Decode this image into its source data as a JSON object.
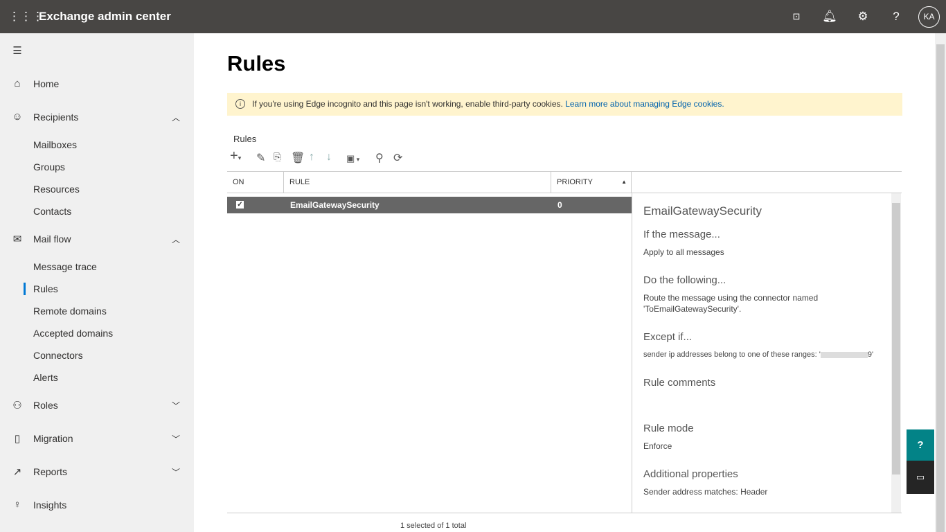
{
  "header": {
    "app_title": "Exchange admin center",
    "avatar": "KA",
    "icons": [
      "waffle-icon",
      "terminal-icon",
      "bell-icon",
      "gear-icon",
      "help-icon"
    ]
  },
  "sidebar": {
    "items": [
      {
        "label": "Home",
        "icon": "home-icon"
      },
      {
        "label": "Recipients",
        "icon": "person-icon",
        "expanded": true,
        "children": [
          "Mailboxes",
          "Groups",
          "Resources",
          "Contacts"
        ]
      },
      {
        "label": "Mail flow",
        "icon": "mail-icon",
        "expanded": true,
        "children": [
          "Message trace",
          "Rules",
          "Remote domains",
          "Accepted domains",
          "Connectors",
          "Alerts"
        ]
      },
      {
        "label": "Roles",
        "icon": "roles-icon"
      },
      {
        "label": "Migration",
        "icon": "migration-icon"
      },
      {
        "label": "Reports",
        "icon": "chart-icon"
      },
      {
        "label": "Insights",
        "icon": "lightbulb-icon"
      }
    ],
    "selected": "Rules"
  },
  "page": {
    "title": "Rules",
    "banner": {
      "text": "If you're using Edge incognito and this page isn't working, enable third-party cookies.",
      "link": "Learn more about managing Edge cookies."
    },
    "section_label": "Rules",
    "table": {
      "columns": [
        "ON",
        "RULE",
        "PRIORITY"
      ],
      "rows": [
        {
          "on": true,
          "rule": "EmailGatewaySecurity",
          "priority": "0"
        }
      ],
      "footer": "1 selected of 1 total"
    },
    "detail": {
      "title": "EmailGatewaySecurity",
      "if_heading": "If the message...",
      "if_text": "Apply to all messages",
      "do_heading": "Do the following...",
      "do_text1": "Route the message using the connector named",
      "do_text2": "'ToEmailGatewaySecurity'.",
      "except_heading": "Except if...",
      "except_text": "sender ip addresses belong to one of these ranges: '",
      "except_tail": "9'",
      "comments_heading": "Rule comments",
      "mode_heading": "Rule mode",
      "mode_text": "Enforce",
      "props_heading": "Additional properties",
      "props_text": "Sender address matches: Header"
    }
  }
}
